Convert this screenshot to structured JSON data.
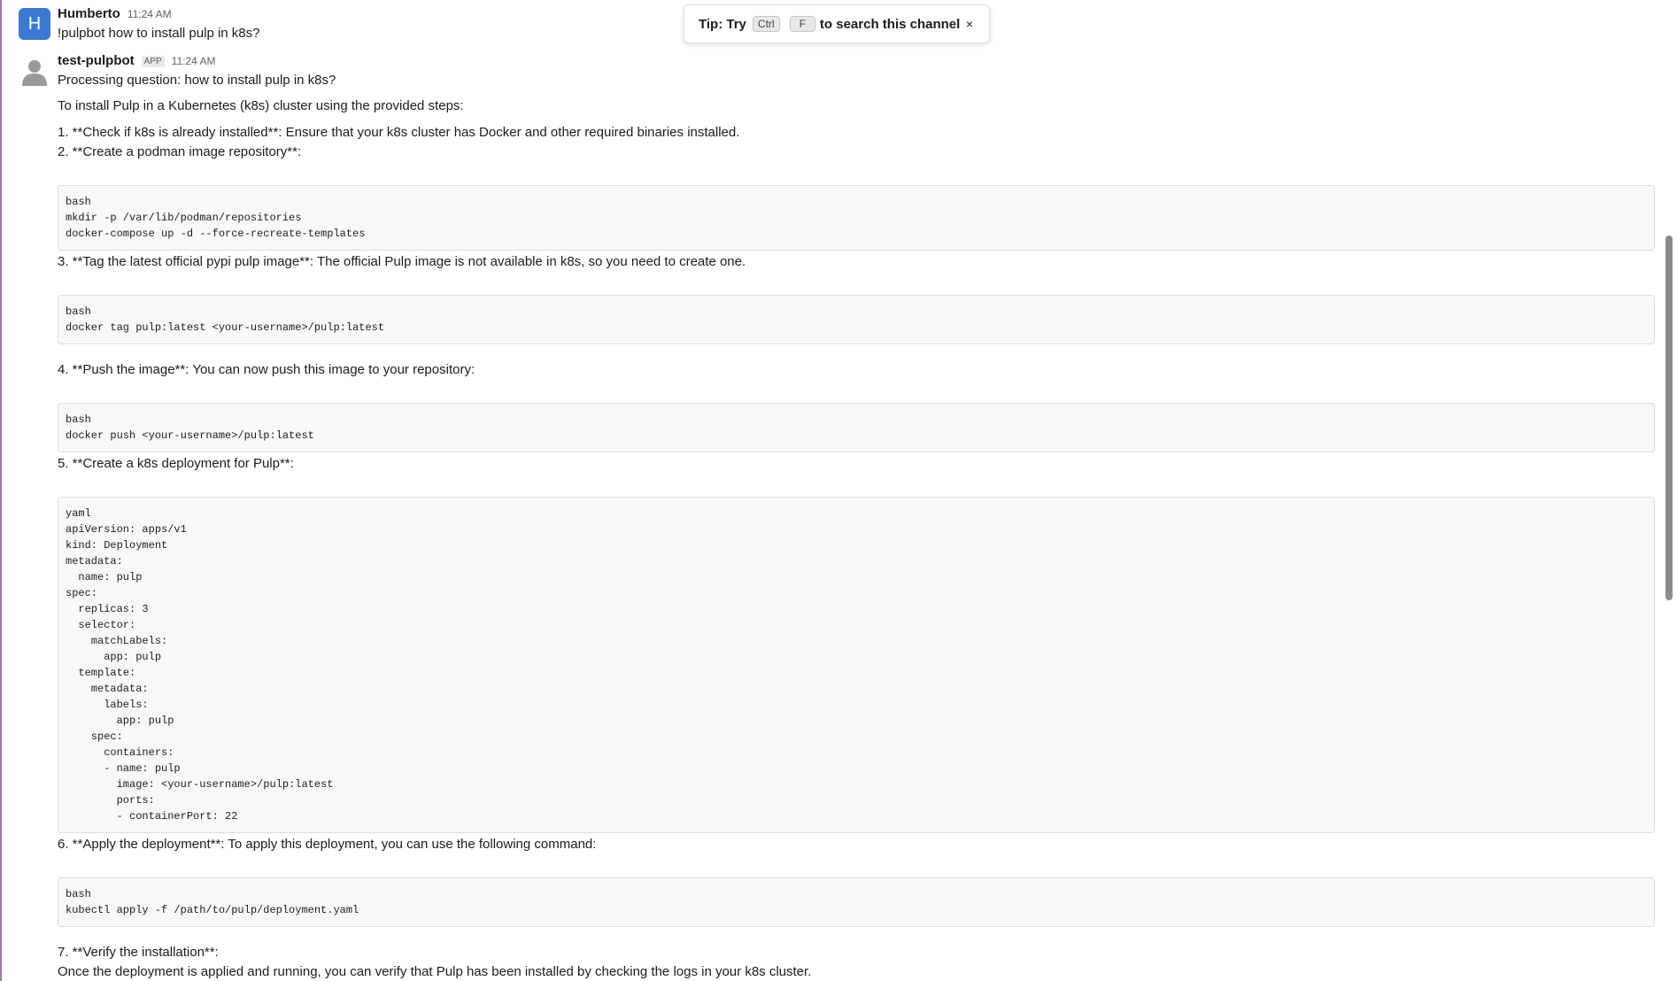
{
  "tip": {
    "prefix": "Tip: Try",
    "key1": "Ctrl",
    "key2": "F",
    "suffix": "to search this channel",
    "close": "×"
  },
  "messages": [
    {
      "sender": "Humberto",
      "avatar_initial": "H",
      "avatar_color": "#3b7ad0",
      "time": "11:24 AM",
      "text": "!pulpbot how to install pulp in k8s?"
    },
    {
      "sender": "test-pulpbot",
      "badge": "APP",
      "time": "11:24 AM",
      "avatar_icon": "person-silhouette-icon",
      "lines": [
        "Processing question: how to install pulp in k8s?",
        "To install Pulp in a Kubernetes (k8s) cluster using the provided steps:",
        "1. **Check if k8s is already installed**: Ensure that your k8s cluster has Docker and other required binaries installed.",
        "2. **Create a podman image repository**:",
        "3. **Tag the latest official pypi pulp image**: The official Pulp image is not available in k8s, so you need to create one.",
        "4. **Push the image**: You can now push this image to your repository:",
        "5. **Create a k8s deployment for Pulp**:",
        "6. **Apply the deployment**: To apply this deployment, you can use the following command:",
        "7. **Verify the installation**:",
        "   Once the deployment is applied and running, you can verify that Pulp has been installed by checking the logs in your k8s cluster."
      ],
      "code_blocks": [
        "bash\nmkdir -p /var/lib/podman/repositories\ndocker-compose up -d --force-recreate-templates",
        "bash\ndocker tag pulp:latest <your-username>/pulp:latest",
        "bash\ndocker push <your-username>/pulp:latest",
        "yaml\napiVersion: apps/v1\nkind: Deployment\nmetadata:\n  name: pulp\nspec:\n  replicas: 3\n  selector:\n    matchLabels:\n      app: pulp\n  template:\n    metadata:\n      labels:\n        app: pulp\n    spec:\n      containers:\n      - name: pulp\n        image: <your-username>/pulp:latest\n        ports:\n        - containerPort: 22",
        "bash\nkubectl apply -f /path/to/pulp/deployment.yaml"
      ]
    }
  ]
}
